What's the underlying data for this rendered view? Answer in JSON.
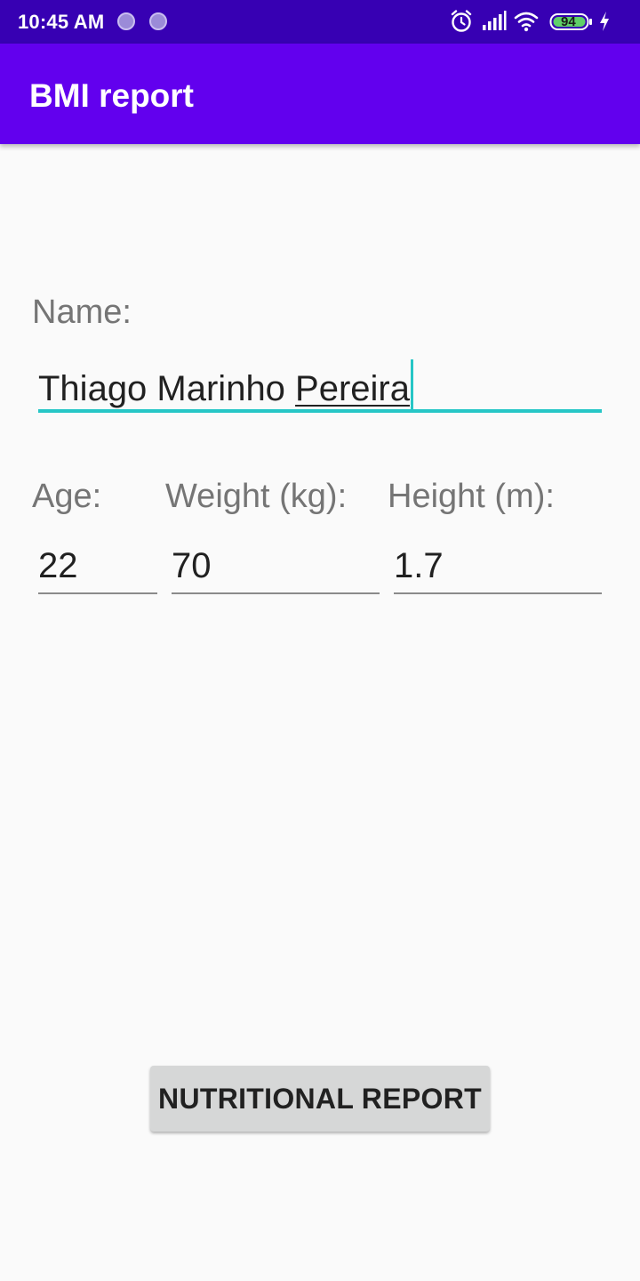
{
  "status_bar": {
    "time": "10:45 AM",
    "battery_level": "94",
    "icons": [
      "notification-dot-icon",
      "notification-dot-icon",
      "alarm-icon",
      "signal-icon",
      "wifi-icon",
      "battery-icon",
      "charging-icon"
    ],
    "background_color": "#3700b3"
  },
  "app_bar": {
    "title": "BMI report",
    "background_color": "#6200ee"
  },
  "form": {
    "name_label": "Name:",
    "name_value_plain": "Thiago Marinho ",
    "name_value_underlined": "Pereira",
    "age_label": "Age:",
    "age_value": "22",
    "weight_label": "Weight (kg):",
    "weight_value": "70",
    "height_label": "Height (m):",
    "height_value": "1.7",
    "focus_color": "#26c6c6"
  },
  "actions": {
    "report_button_label": "NUTRITIONAL REPORT"
  }
}
